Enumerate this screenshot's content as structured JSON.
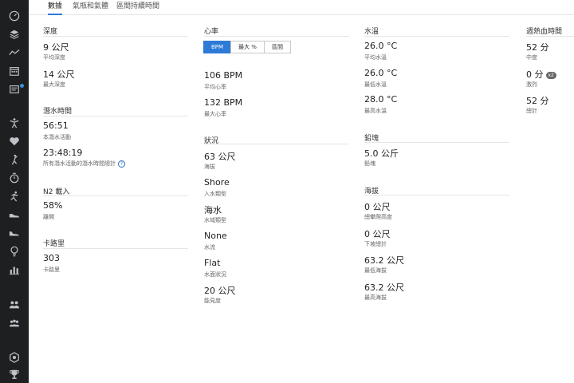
{
  "tabs": [
    "數據",
    "氣瓶和氣體",
    "區間持續時間"
  ],
  "depth": {
    "title": "深度",
    "avg_value": "9 公尺",
    "avg_label": "平均深度",
    "max_value": "14 公尺",
    "max_label": "最大深度"
  },
  "dive_time": {
    "title": "潛水時間",
    "this_value": "56:51",
    "this_label": "本潛水活動",
    "total_value": "23:48:19",
    "total_label": "所有潛水活動的潛水時間總計"
  },
  "n2": {
    "title": "N2 載入",
    "value": "58%",
    "label": "離開"
  },
  "calories": {
    "title": "卡路里",
    "value": "303",
    "label": "卡路里"
  },
  "heart_rate": {
    "title": "心率",
    "buttons": [
      "BPM",
      "最大 %",
      "區間"
    ],
    "avg_value": "106 BPM",
    "avg_label": "平均心率",
    "max_value": "132 BPM",
    "max_label": "最大心率"
  },
  "conditions": {
    "title": "狀況",
    "items": [
      {
        "value": "63 公尺",
        "label": "海拔"
      },
      {
        "value": "Shore",
        "label": "入水類型"
      },
      {
        "value": "海水",
        "label": "水域類型"
      },
      {
        "value": "None",
        "label": "水流"
      },
      {
        "value": "Flat",
        "label": "水面狀況"
      },
      {
        "value": "20 公尺",
        "label": "能見度"
      }
    ]
  },
  "water_temp": {
    "title": "水溫",
    "avg_value": "26.0 °C",
    "avg_label": "平均水溫",
    "min_value": "26.0 °C",
    "min_label": "最低水溫",
    "max_value": "28.0 °C",
    "max_label": "最高水溫"
  },
  "weight": {
    "title": "鉛塊",
    "value": "5.0 公斤",
    "label": "鉛塊"
  },
  "elevation": {
    "title": "海拔",
    "items": [
      {
        "value": "0 公尺",
        "label": "總攀爬高度"
      },
      {
        "value": "0 公尺",
        "label": "下坡總計"
      },
      {
        "value": "63.2 公尺",
        "label": "最低海拔"
      },
      {
        "value": "63.2 公尺",
        "label": "最高海拔"
      }
    ]
  },
  "intensity": {
    "title": "週熱血時間",
    "moderate_value": "52 分",
    "moderate_label": "中度",
    "vigorous_value": "0 分",
    "vigorous_badge": "x2",
    "vigorous_label": "激烈",
    "total_value": "52 分",
    "total_label": "總計"
  },
  "colors": {
    "sidebar": "#1d1f21",
    "accent": "#2d7bd6"
  }
}
